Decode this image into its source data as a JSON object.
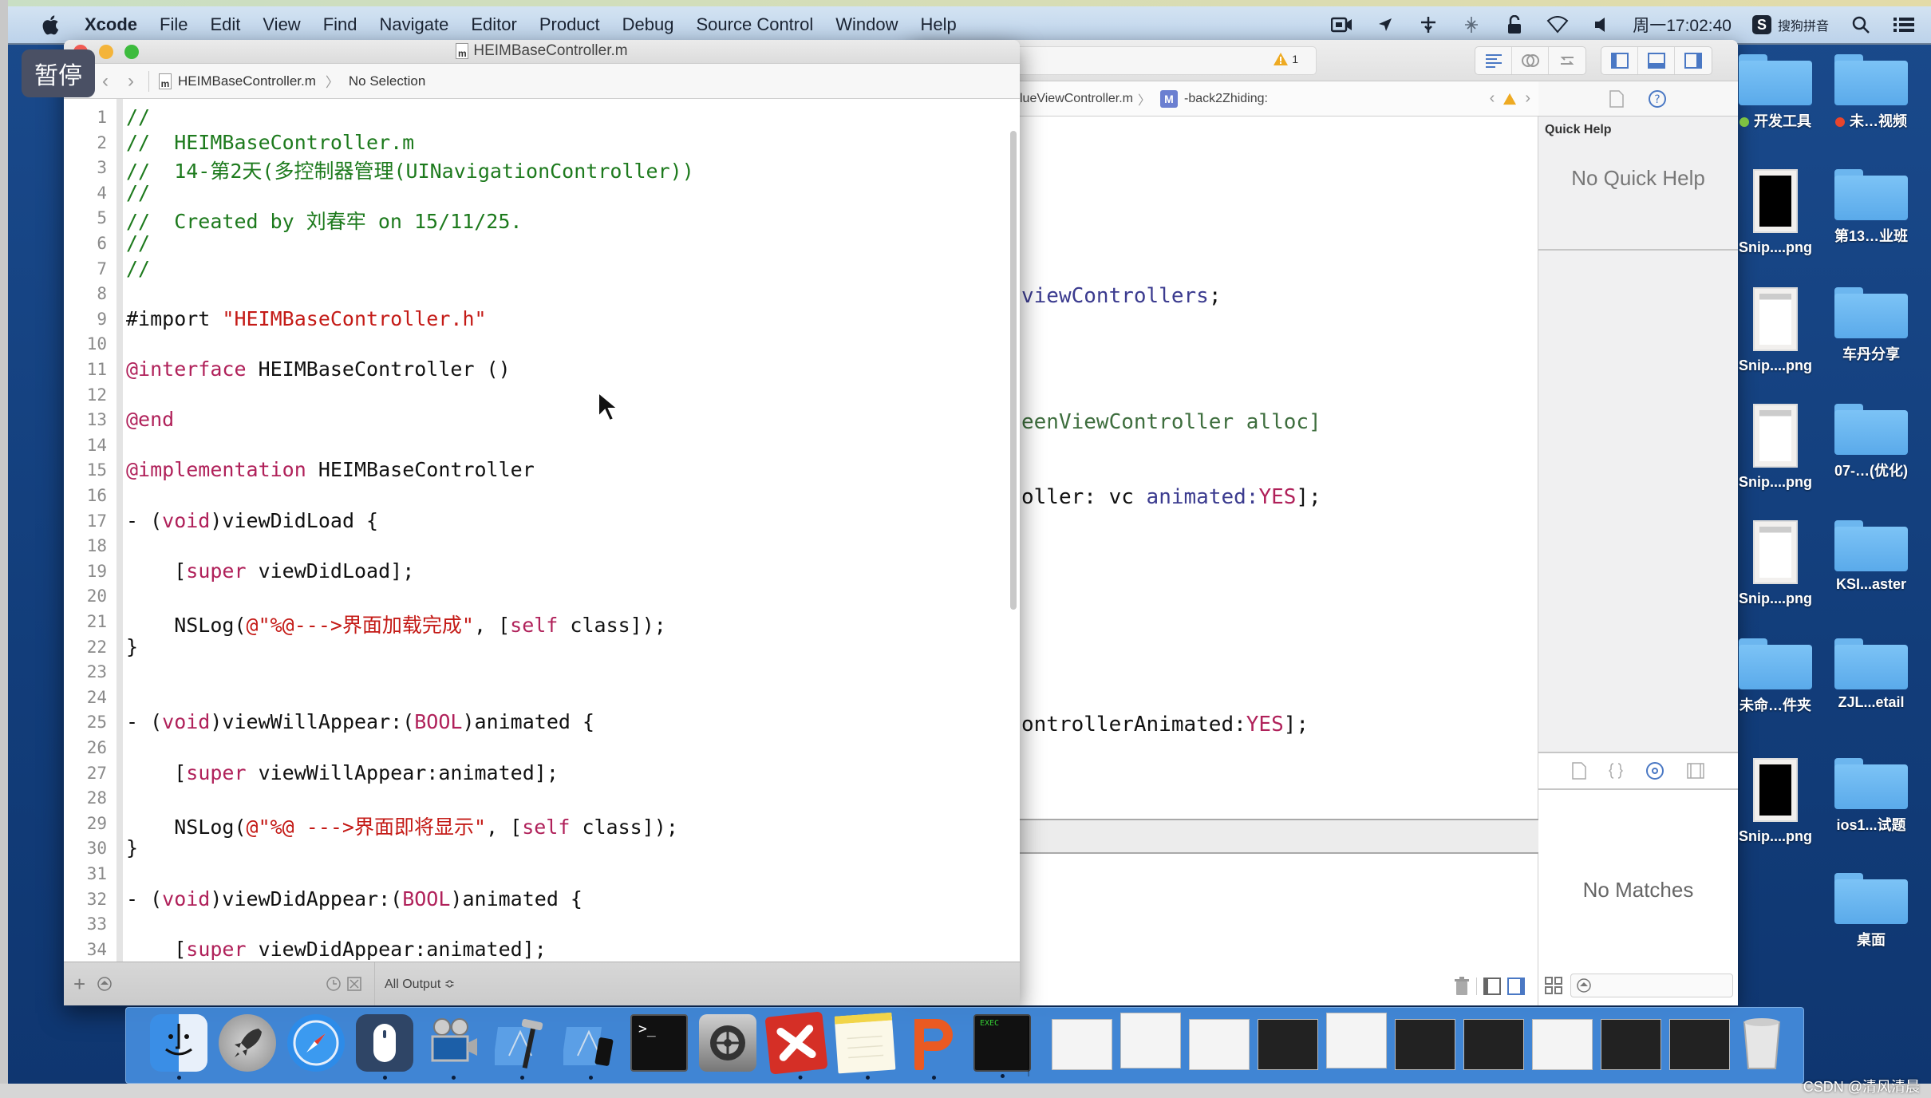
{
  "menubar": {
    "app_name": "Xcode",
    "menus": [
      "File",
      "Edit",
      "View",
      "Find",
      "Navigate",
      "Editor",
      "Product",
      "Debug",
      "Source Control",
      "Window",
      "Help"
    ],
    "status": {
      "clock": "周一17:02:40",
      "input_method": "搜狗拼音",
      "ime_badge": "S"
    }
  },
  "overlay": {
    "pause_label": "暂停"
  },
  "front_window": {
    "title": "HEIMBaseController.m",
    "file_icon_letter": "m",
    "jumpbar": {
      "file": "HEIMBaseController.m",
      "selection": "No Selection"
    },
    "code_lines": [
      {
        "n": "1",
        "parts": [
          {
            "t": "//",
            "c": "comment"
          }
        ]
      },
      {
        "n": "2",
        "parts": [
          {
            "t": "//  HEIMBaseController.m",
            "c": "comment"
          }
        ]
      },
      {
        "n": "3",
        "parts": [
          {
            "t": "//  14-第2天(多控制器管理(UINavigationController))",
            "c": "comment"
          }
        ]
      },
      {
        "n": "4",
        "parts": [
          {
            "t": "//",
            "c": "comment"
          }
        ]
      },
      {
        "n": "5",
        "parts": [
          {
            "t": "//  Created by 刘春牢 on 15/11/25.",
            "c": "comment"
          }
        ]
      },
      {
        "n": "6",
        "parts": [
          {
            "t": "//",
            "c": "comment"
          }
        ]
      },
      {
        "n": "7",
        "parts": [
          {
            "t": "//",
            "c": "comment"
          }
        ]
      },
      {
        "n": "8",
        "parts": []
      },
      {
        "n": "9",
        "parts": [
          {
            "t": "#import ",
            "c": "plain"
          },
          {
            "t": "\"HEIMBaseController.h\"",
            "c": "str"
          }
        ]
      },
      {
        "n": "10",
        "parts": []
      },
      {
        "n": "11",
        "parts": [
          {
            "t": "@interface",
            "c": "kw"
          },
          {
            "t": " HEIMBaseController ()",
            "c": "plain"
          }
        ]
      },
      {
        "n": "12",
        "parts": []
      },
      {
        "n": "13",
        "parts": [
          {
            "t": "@end",
            "c": "kw"
          }
        ]
      },
      {
        "n": "14",
        "parts": []
      },
      {
        "n": "15",
        "parts": [
          {
            "t": "@implementation",
            "c": "kw"
          },
          {
            "t": " HEIMBaseController",
            "c": "plain"
          }
        ]
      },
      {
        "n": "16",
        "parts": []
      },
      {
        "n": "17",
        "parts": [
          {
            "t": "- (",
            "c": "plain"
          },
          {
            "t": "void",
            "c": "kw"
          },
          {
            "t": ")viewDidLoad {",
            "c": "plain"
          }
        ]
      },
      {
        "n": "18",
        "parts": []
      },
      {
        "n": "19",
        "parts": [
          {
            "t": "    [",
            "c": "plain"
          },
          {
            "t": "super",
            "c": "kw"
          },
          {
            "t": " viewDidLoad];",
            "c": "plain"
          }
        ]
      },
      {
        "n": "20",
        "parts": []
      },
      {
        "n": "21",
        "parts": [
          {
            "t": "    NSLog(",
            "c": "plain"
          },
          {
            "t": "@\"%@--->界面加载完成\"",
            "c": "str"
          },
          {
            "t": ", [",
            "c": "plain"
          },
          {
            "t": "self",
            "c": "kw"
          },
          {
            "t": " class]);",
            "c": "plain"
          }
        ]
      },
      {
        "n": "22",
        "parts": [
          {
            "t": "}",
            "c": "plain"
          }
        ]
      },
      {
        "n": "23",
        "parts": []
      },
      {
        "n": "24",
        "parts": []
      },
      {
        "n": "25",
        "parts": [
          {
            "t": "- (",
            "c": "plain"
          },
          {
            "t": "void",
            "c": "kw"
          },
          {
            "t": ")viewWillAppear:(",
            "c": "plain"
          },
          {
            "t": "BOOL",
            "c": "kw"
          },
          {
            "t": ")animated {",
            "c": "plain"
          }
        ]
      },
      {
        "n": "26",
        "parts": []
      },
      {
        "n": "27",
        "parts": [
          {
            "t": "    [",
            "c": "plain"
          },
          {
            "t": "super",
            "c": "kw"
          },
          {
            "t": " viewWillAppear:animated];",
            "c": "plain"
          }
        ]
      },
      {
        "n": "28",
        "parts": []
      },
      {
        "n": "29",
        "parts": [
          {
            "t": "    NSLog(",
            "c": "plain"
          },
          {
            "t": "@\"%@ --->界面即将显示\"",
            "c": "str"
          },
          {
            "t": ", [",
            "c": "plain"
          },
          {
            "t": "self",
            "c": "kw"
          },
          {
            "t": " class]);",
            "c": "plain"
          }
        ]
      },
      {
        "n": "30",
        "parts": [
          {
            "t": "}",
            "c": "plain"
          }
        ]
      },
      {
        "n": "31",
        "parts": []
      },
      {
        "n": "32",
        "parts": [
          {
            "t": "- (",
            "c": "plain"
          },
          {
            "t": "void",
            "c": "kw"
          },
          {
            "t": ")viewDidAppear:(",
            "c": "plain"
          },
          {
            "t": "BOOL",
            "c": "kw"
          },
          {
            "t": ")animated {",
            "c": "plain"
          }
        ]
      },
      {
        "n": "33",
        "parts": []
      },
      {
        "n": "34",
        "parts": [
          {
            "t": "    [",
            "c": "plain"
          },
          {
            "t": "super",
            "c": "kw"
          },
          {
            "t": " viewDidAppear:animated];",
            "c": "plain"
          }
        ]
      }
    ],
    "bottom_bar": {
      "output_selector": "All Output ≎"
    }
  },
  "back_window": {
    "activity": {
      "warning_count": "1"
    },
    "jumpbar": {
      "file": "lueViewController.m",
      "method_badge": "M",
      "method": "-back2Zhiding:"
    },
    "code_fragments": [
      {
        "parts": [
          {
            "t": "viewControllers",
            "c": "purple"
          },
          {
            "t": ";",
            "c": "plain"
          }
        ]
      },
      {
        "parts": [
          {
            "t": "eenViewController alloc]",
            "c": "green"
          }
        ]
      },
      {
        "parts": [
          {
            "t": "oller: vc ",
            "c": "plain"
          },
          {
            "t": "animated:",
            "c": "purple"
          },
          {
            "t": "YES",
            "c": "kw"
          },
          {
            "t": "];",
            "c": "plain"
          }
        ]
      },
      {
        "parts": [
          {
            "t": "ontrollerAnimated:",
            "c": "plain"
          },
          {
            "t": "YES",
            "c": "kw"
          },
          {
            "t": "];",
            "c": "plain"
          }
        ]
      }
    ],
    "inspector": {
      "quick_help_title": "Quick Help",
      "quick_help_empty": "No Quick Help",
      "library_empty": "No Matches"
    }
  },
  "desktop": {
    "items": [
      {
        "label": "开发工具",
        "kind": "folder",
        "tag": "#7dc242"
      },
      {
        "label": "未…视频",
        "kind": "folder",
        "tag": "#e8452c"
      },
      {
        "label": "Snip....png",
        "kind": "png-black"
      },
      {
        "label": "第13…业班",
        "kind": "folder"
      },
      {
        "label": "Snip....png",
        "kind": "png-light"
      },
      {
        "label": "车丹分享",
        "kind": "folder"
      },
      {
        "label": "Snip....png",
        "kind": "png-light"
      },
      {
        "label": "07-…(优化)",
        "kind": "folder"
      },
      {
        "label": "Snip....png",
        "kind": "png-light"
      },
      {
        "label": "KSI...aster",
        "kind": "folder"
      },
      {
        "label": "未命…件夹",
        "kind": "folder"
      },
      {
        "label": "ZJL...etail",
        "kind": "folder"
      },
      {
        "label": "Snip....png",
        "kind": "png-black"
      },
      {
        "label": "ios1...试题",
        "kind": "folder"
      },
      {
        "label": "桌面",
        "kind": "folder"
      }
    ]
  },
  "dock": {
    "apps": [
      {
        "name": "Finder",
        "running": true
      },
      {
        "name": "Launchpad",
        "running": false
      },
      {
        "name": "Safari",
        "running": false
      },
      {
        "name": "Mouse app",
        "running": true
      },
      {
        "name": "Video app",
        "running": true
      },
      {
        "name": "Xcode",
        "running": true
      },
      {
        "name": "Simulator",
        "running": true
      },
      {
        "name": "Terminal",
        "running": false
      },
      {
        "name": "System Preferences",
        "running": false
      },
      {
        "name": "XMind",
        "running": true
      },
      {
        "name": "Notes",
        "running": true
      },
      {
        "name": "Keynote/P app",
        "running": true
      },
      {
        "name": "Console",
        "running": true
      }
    ],
    "minimized_windows": 10,
    "trash": "Trash"
  },
  "watermark": "CSDN @清风清晨",
  "colors": {
    "comment": "#1d7a1d",
    "keyword": "#b0215a",
    "string": "#c41a16",
    "purple": "#3b3b8f",
    "green": "#3e6e3e",
    "desktop": "#1a4a8c",
    "dock": "#448cdc"
  }
}
